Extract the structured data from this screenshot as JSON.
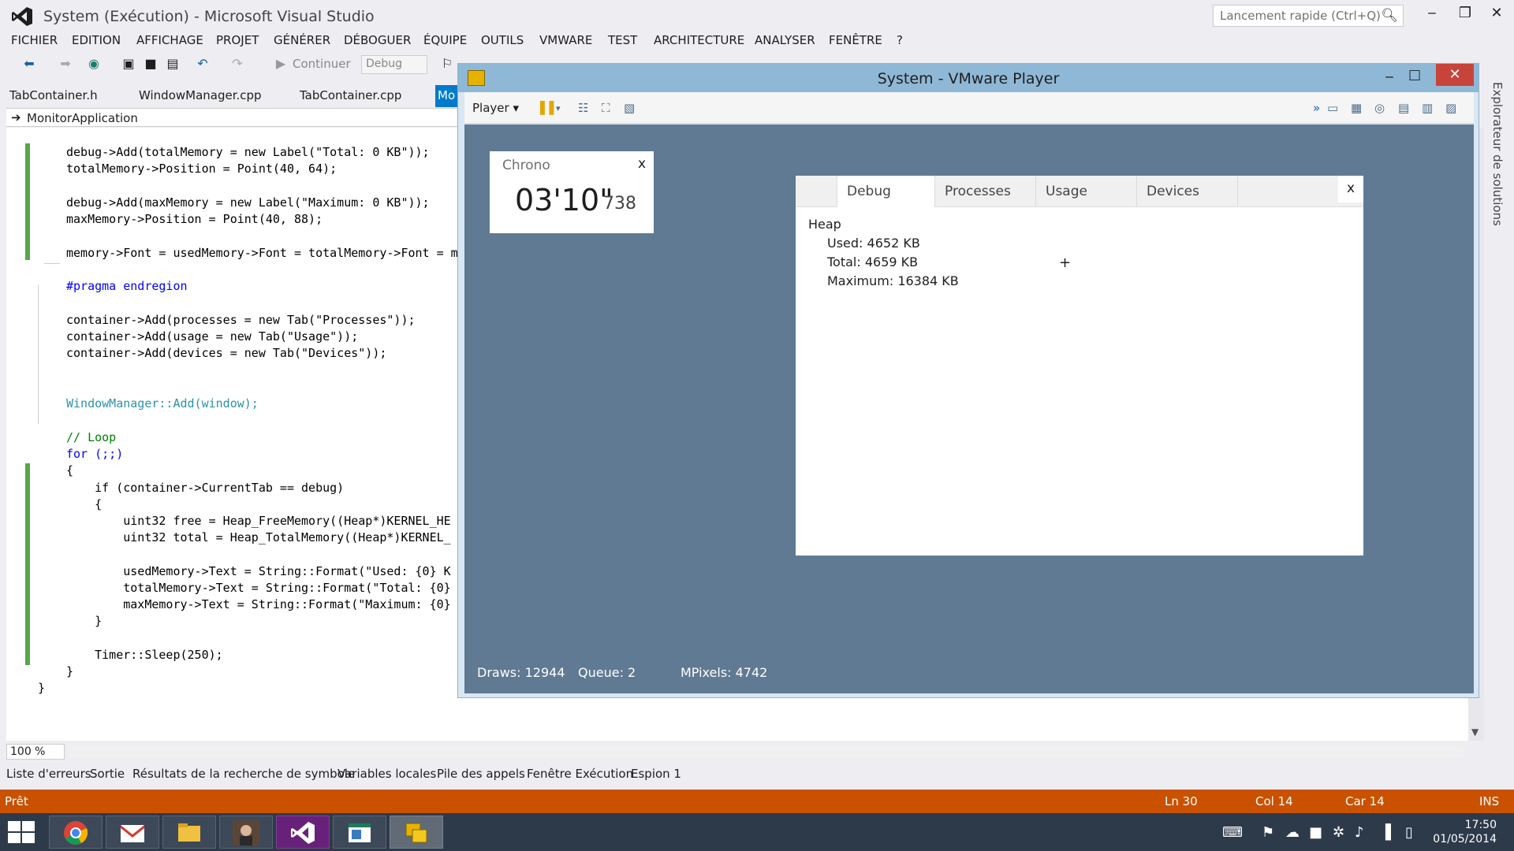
{
  "vs": {
    "title": "System (Exécution) - Microsoft Visual Studio",
    "quick_launch_placeholder": "Lancement rapide (Ctrl+Q)",
    "menu": [
      "FICHIER",
      "EDITION",
      "AFFICHAGE",
      "PROJET",
      "GÉNÉRER",
      "DÉBOGUER",
      "ÉQUIPE",
      "OUTILS",
      "VMWARE",
      "TEST",
      "ARCHITECTURE",
      "ANALYSER",
      "FENÊTRE",
      "?"
    ],
    "toolbar": {
      "continue_label": "Continuer",
      "config": "Debug"
    },
    "tabs": [
      "TabContainer.h",
      "WindowManager.cpp",
      "TabContainer.cpp",
      "Mo"
    ],
    "navbar_label": "MonitorApplication",
    "zoom": "100 %",
    "side_panel": "Explorateur de solutions",
    "bottom_tabs": [
      "Liste d'erreurs",
      "Sortie",
      "Résultats de la recherche de symbole",
      "Variables locales",
      "Pile des appels",
      "Fenêtre Exécution",
      "Espion 1"
    ],
    "status": {
      "ready": "Prêt",
      "line": "Ln 30",
      "col": "Col 14",
      "car": "Car 14",
      "ins": "INS"
    }
  },
  "code": [
    "debug->Add(totalMemory = new Label(\"Total: 0 KB\"));",
    "totalMemory->Position = Point(40, 64);",
    "debug->Add(maxMemory = new Label(\"Maximum: 0 KB\"));",
    "maxMemory->Position = Point(40, 88);",
    "memory->Font = usedMemory->Font = totalMemory->Font = m",
    "#pragma endregion",
    "container->Add(processes = new Tab(\"Processes\"));",
    "container->Add(usage = new Tab(\"Usage\"));",
    "container->Add(devices = new Tab(\"Devices\"));",
    "WindowManager::Add(window);",
    "// Loop",
    "for (;;)",
    "{",
    "    if (container->CurrentTab == debug)",
    "    {",
    "        uint32 free = Heap_FreeMemory((Heap*)KERNEL_HE",
    "        uint32 total = Heap_TotalMemory((Heap*)KERNEL_",
    "        usedMemory->Text = String::Format(\"Used: {0} K",
    "        totalMemory->Text = String::Format(\"Total: {0}",
    "        maxMemory->Text = String::Format(\"Maximum: {0}",
    "    }",
    "    Timer::Sleep(250);",
    "}",
    "}"
  ],
  "vmware": {
    "title": "System - VMware Player",
    "player_menu": "Player",
    "chrono": {
      "title": "Chrono",
      "close": "x",
      "time": "03'10\"",
      "ms": "738"
    },
    "debug_window": {
      "tabs": [
        "Debug",
        "Processes",
        "Usage",
        "Devices"
      ],
      "close": "x",
      "heap_title": "Heap",
      "used": "Used: 4652 KB",
      "total": "Total: 4659 KB",
      "maximum": "Maximum: 16384 KB"
    },
    "stats": {
      "draws": "Draws: 12944",
      "queue": "Queue: 2",
      "mpixels": "MPixels: 4742"
    }
  },
  "taskbar": {
    "time": "17:50",
    "date": "01/05/2014"
  },
  "colors": {
    "vs_accent": "#007acc",
    "status_bar": "#ca5100",
    "vm_screen": "#5f7a92",
    "taskbar": "#2d3a4a"
  }
}
